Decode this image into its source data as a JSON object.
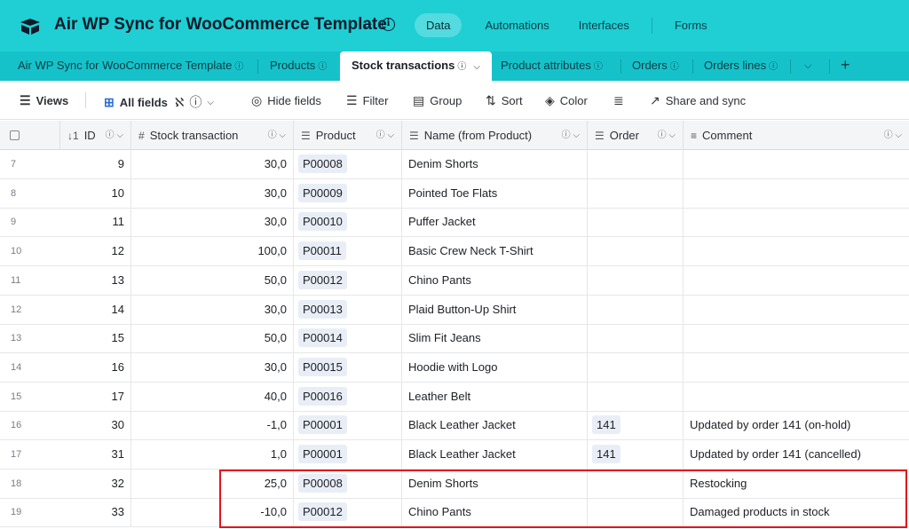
{
  "app": {
    "title": "Air WP Sync for WooCommerce Template",
    "nav": [
      "Data",
      "Automations",
      "Interfaces",
      "Forms"
    ],
    "active_nav": "Data",
    "info_icon": "info-circle-icon"
  },
  "tabs": [
    {
      "label": "Air WP Sync for WooCommerce Template",
      "active": false
    },
    {
      "label": "Products",
      "active": false
    },
    {
      "label": "Stock transactions",
      "active": true
    },
    {
      "label": "Product attributes",
      "active": false
    },
    {
      "label": "Orders",
      "active": false
    },
    {
      "label": "Orders lines",
      "active": false
    }
  ],
  "toolbar": {
    "views": "Views",
    "all_fields": "All fields",
    "hide_fields": "Hide fields",
    "filter": "Filter",
    "group": "Group",
    "sort": "Sort",
    "color": "Color",
    "share": "Share and sync"
  },
  "columns": {
    "id": "ID",
    "stock": "Stock transaction",
    "product": "Product",
    "name": "Name (from Product)",
    "order": "Order",
    "comment": "Comment"
  },
  "rows": [
    {
      "n": "7",
      "id": "9",
      "stock": "30,0",
      "product": "P00008",
      "name": "Denim Shorts",
      "order": "",
      "comment": ""
    },
    {
      "n": "8",
      "id": "10",
      "stock": "30,0",
      "product": "P00009",
      "name": "Pointed Toe Flats",
      "order": "",
      "comment": ""
    },
    {
      "n": "9",
      "id": "11",
      "stock": "30,0",
      "product": "P00010",
      "name": "Puffer Jacket",
      "order": "",
      "comment": ""
    },
    {
      "n": "10",
      "id": "12",
      "stock": "100,0",
      "product": "P00011",
      "name": "Basic Crew Neck T-Shirt",
      "order": "",
      "comment": ""
    },
    {
      "n": "11",
      "id": "13",
      "stock": "50,0",
      "product": "P00012",
      "name": "Chino Pants",
      "order": "",
      "comment": ""
    },
    {
      "n": "12",
      "id": "14",
      "stock": "30,0",
      "product": "P00013",
      "name": "Plaid Button-Up Shirt",
      "order": "",
      "comment": ""
    },
    {
      "n": "13",
      "id": "15",
      "stock": "50,0",
      "product": "P00014",
      "name": "Slim Fit Jeans",
      "order": "",
      "comment": ""
    },
    {
      "n": "14",
      "id": "16",
      "stock": "30,0",
      "product": "P00015",
      "name": "Hoodie with Logo",
      "order": "",
      "comment": ""
    },
    {
      "n": "15",
      "id": "17",
      "stock": "40,0",
      "product": "P00016",
      "name": "Leather Belt",
      "order": "",
      "comment": ""
    },
    {
      "n": "16",
      "id": "30",
      "stock": "-1,0",
      "product": "P00001",
      "name": "Black Leather Jacket",
      "order": "141",
      "comment": "Updated by order 141 (on-hold)"
    },
    {
      "n": "17",
      "id": "31",
      "stock": "1,0",
      "product": "P00001",
      "name": "Black Leather Jacket",
      "order": "141",
      "comment": "Updated by order 141 (cancelled)"
    },
    {
      "n": "18",
      "id": "32",
      "stock": "25,0",
      "product": "P00008",
      "name": "Denim Shorts",
      "order": "",
      "comment": "Restocking"
    },
    {
      "n": "19",
      "id": "33",
      "stock": "-10,0",
      "product": "P00012",
      "name": "Chino Pants",
      "order": "",
      "comment": "Damaged products in stock"
    }
  ],
  "colors": {
    "appbar": "#1fcfd4",
    "tabbar": "#16c2c9",
    "highlight": "#e3131c"
  }
}
